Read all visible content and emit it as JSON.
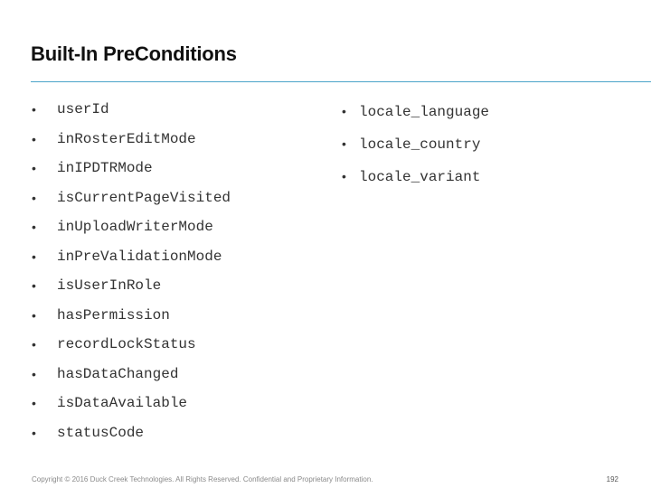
{
  "slide": {
    "title": "Built-In PreConditions",
    "left_column": [
      "userId",
      "inRosterEditMode",
      "inIPDTRMode",
      "isCurrentPageVisited",
      "inUploadWriterMode",
      "inPreValidationMode",
      "isUserInRole",
      "hasPermission",
      "recordLockStatus",
      "hasDataChanged",
      "isDataAvailable",
      "statusCode"
    ],
    "right_column": [
      "locale_language",
      "locale_country",
      "locale_variant"
    ],
    "bullet_glyph": "•"
  },
  "footer": {
    "copyright": "Copyright © 2016 Duck Creek Technologies. All Rights Reserved. Confidential and Proprietary Information.",
    "page_number": "192"
  },
  "colors": {
    "title_rule": "#4aa3c9",
    "title_text": "#111111",
    "body_text": "#333333",
    "footer_text": "#8a8a8a"
  }
}
